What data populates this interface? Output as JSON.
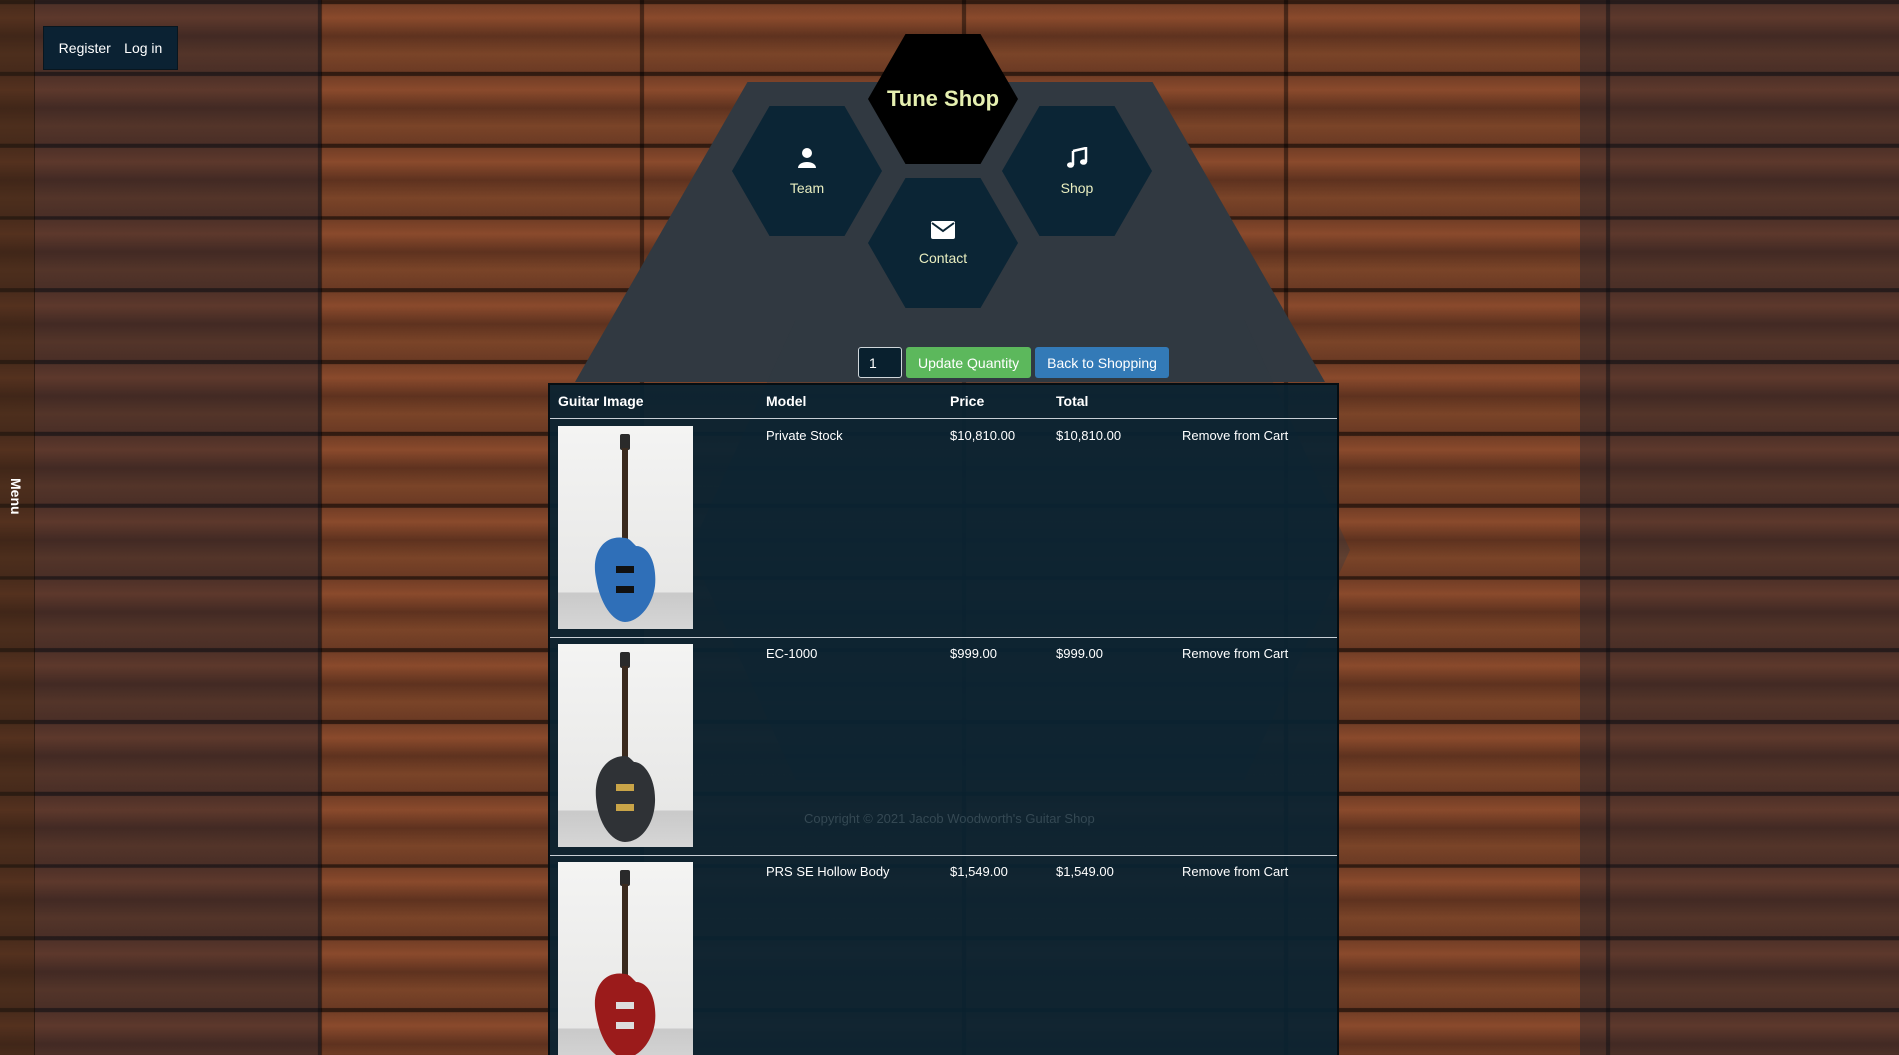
{
  "side_menu": {
    "label": "Menu"
  },
  "auth": {
    "register": "Register",
    "login": "Log in"
  },
  "brand": {
    "title": "Tune Shop"
  },
  "nav": {
    "team": "Team",
    "shop": "Shop",
    "contact": "Contact"
  },
  "cart_controls": {
    "quantity": "1",
    "update_label": "Update Quantity",
    "back_label": "Back to Shopping"
  },
  "cart": {
    "columns": {
      "image": "Guitar Image",
      "model": "Model",
      "price": "Price",
      "total": "Total"
    },
    "items": [
      {
        "model": "Private Stock",
        "price": "$10,810.00",
        "total": "$10,810.00",
        "remove": "Remove from Cart",
        "guitar_color": "#2f6fb8"
      },
      {
        "model": "EC-1000",
        "price": "$999.00",
        "total": "$999.00",
        "remove": "Remove from Cart",
        "guitar_color": "#2f3236"
      },
      {
        "model": "PRS SE Hollow Body",
        "price": "$1,549.00",
        "total": "$1,549.00",
        "remove": "Remove from Cart",
        "guitar_color": "#9b1b1b"
      }
    ]
  },
  "footer": {
    "copyright": "Copyright © 2021 Jacob Woodworth's Guitar Shop"
  },
  "colors": {
    "hex_text": "#e9eec0",
    "panel": "#092232",
    "update_button": "#5cb85c",
    "back_button": "#337ab7"
  }
}
